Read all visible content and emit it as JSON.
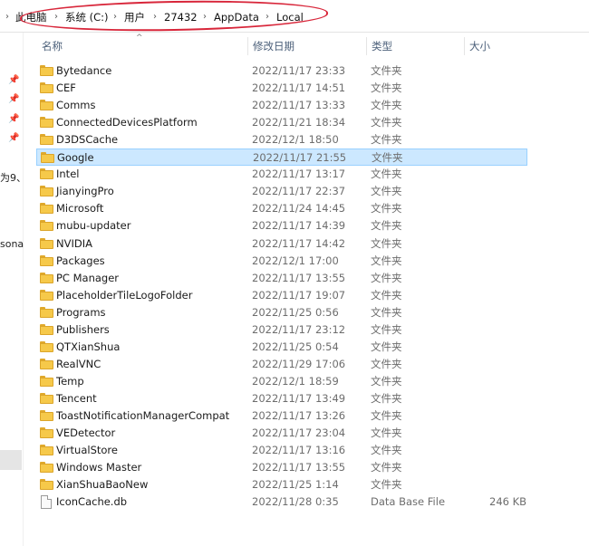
{
  "breadcrumb": [
    {
      "label": "此电脑"
    },
    {
      "label": "系统 (C:)"
    },
    {
      "label": "用户"
    },
    {
      "label": "27432"
    },
    {
      "label": "AppData"
    },
    {
      "label": "Local"
    }
  ],
  "nav_pane": {
    "fragments": [
      "为9、",
      "sona"
    ]
  },
  "columns": {
    "name": "名称",
    "date": "修改日期",
    "type": "类型",
    "size": "大小"
  },
  "files": [
    {
      "name": "Bytedance",
      "date": "2022/11/17 23:33",
      "type": "文件夹",
      "size": "",
      "icon": "folder-icon"
    },
    {
      "name": "CEF",
      "date": "2022/11/17 14:51",
      "type": "文件夹",
      "size": "",
      "icon": "folder-icon"
    },
    {
      "name": "Comms",
      "date": "2022/11/17 13:33",
      "type": "文件夹",
      "size": "",
      "icon": "folder-icon"
    },
    {
      "name": "ConnectedDevicesPlatform",
      "date": "2022/11/21 18:34",
      "type": "文件夹",
      "size": "",
      "icon": "folder-icon"
    },
    {
      "name": "D3DSCache",
      "date": "2022/12/1 18:50",
      "type": "文件夹",
      "size": "",
      "icon": "folder-icon"
    },
    {
      "name": "Google",
      "date": "2022/11/17 21:55",
      "type": "文件夹",
      "size": "",
      "icon": "folder-icon",
      "selected": true
    },
    {
      "name": "Intel",
      "date": "2022/11/17 13:17",
      "type": "文件夹",
      "size": "",
      "icon": "folder-icon"
    },
    {
      "name": "JianyingPro",
      "date": "2022/11/17 22:37",
      "type": "文件夹",
      "size": "",
      "icon": "folder-icon"
    },
    {
      "name": "Microsoft",
      "date": "2022/11/24 14:45",
      "type": "文件夹",
      "size": "",
      "icon": "folder-icon"
    },
    {
      "name": "mubu-updater",
      "date": "2022/11/17 14:39",
      "type": "文件夹",
      "size": "",
      "icon": "folder-icon"
    },
    {
      "name": "NVIDIA",
      "date": "2022/11/17 14:42",
      "type": "文件夹",
      "size": "",
      "icon": "folder-icon"
    },
    {
      "name": "Packages",
      "date": "2022/12/1 17:00",
      "type": "文件夹",
      "size": "",
      "icon": "folder-icon"
    },
    {
      "name": "PC Manager",
      "date": "2022/11/17 13:55",
      "type": "文件夹",
      "size": "",
      "icon": "folder-icon"
    },
    {
      "name": "PlaceholderTileLogoFolder",
      "date": "2022/11/17 19:07",
      "type": "文件夹",
      "size": "",
      "icon": "folder-icon"
    },
    {
      "name": "Programs",
      "date": "2022/11/25 0:56",
      "type": "文件夹",
      "size": "",
      "icon": "folder-icon"
    },
    {
      "name": "Publishers",
      "date": "2022/11/17 23:12",
      "type": "文件夹",
      "size": "",
      "icon": "folder-icon"
    },
    {
      "name": "QTXianShua",
      "date": "2022/11/25 0:54",
      "type": "文件夹",
      "size": "",
      "icon": "folder-icon"
    },
    {
      "name": "RealVNC",
      "date": "2022/11/29 17:06",
      "type": "文件夹",
      "size": "",
      "icon": "folder-icon"
    },
    {
      "name": "Temp",
      "date": "2022/12/1 18:59",
      "type": "文件夹",
      "size": "",
      "icon": "folder-icon"
    },
    {
      "name": "Tencent",
      "date": "2022/11/17 13:49",
      "type": "文件夹",
      "size": "",
      "icon": "folder-icon"
    },
    {
      "name": "ToastNotificationManagerCompat",
      "date": "2022/11/17 13:26",
      "type": "文件夹",
      "size": "",
      "icon": "folder-icon"
    },
    {
      "name": "VEDetector",
      "date": "2022/11/17 23:04",
      "type": "文件夹",
      "size": "",
      "icon": "folder-icon"
    },
    {
      "name": "VirtualStore",
      "date": "2022/11/17 13:16",
      "type": "文件夹",
      "size": "",
      "icon": "folder-icon"
    },
    {
      "name": "Windows Master",
      "date": "2022/11/17 13:55",
      "type": "文件夹",
      "size": "",
      "icon": "folder-icon"
    },
    {
      "name": "XianShuaBaoNew",
      "date": "2022/11/25 1:14",
      "type": "文件夹",
      "size": "",
      "icon": "folder-icon"
    },
    {
      "name": "IconCache.db",
      "date": "2022/11/28 0:35",
      "type": "Data Base File",
      "size": "246 KB",
      "icon": "file-icon"
    }
  ],
  "colors": {
    "selection_bg": "#cce8ff",
    "selection_border": "#99d1ff",
    "header_text": "#4c607a",
    "annotation_circle": "#d8263a",
    "folder_yellow": "#f6c94a"
  }
}
